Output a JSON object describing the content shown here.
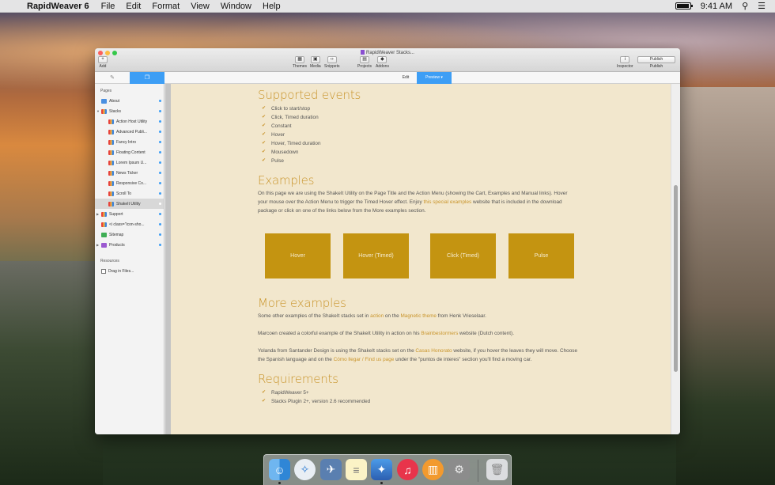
{
  "menubar": {
    "app_name": "RapidWeaver 6",
    "menus": [
      "File",
      "Edit",
      "Format",
      "View",
      "Window",
      "Help"
    ],
    "clock": "9:41 AM"
  },
  "window": {
    "title": "RapidWeaver Stacks...",
    "toolbar": {
      "add": "Add",
      "themes": "Themes",
      "media": "Media",
      "snippets": "Snippets",
      "projects": "Projects",
      "addons": "Addons",
      "inspector": "Inspector",
      "publish_button": "Publish",
      "publish": "Publish"
    },
    "modes": {
      "edit": "Edit",
      "preview": "Preview"
    }
  },
  "sidebar": {
    "pages_header": "Pages",
    "items": [
      {
        "label": "About",
        "icon": "page"
      },
      {
        "label": "Stacks",
        "icon": "stack"
      },
      {
        "label": "Action Host Utility",
        "icon": "stack"
      },
      {
        "label": "Advanced Publi...",
        "icon": "stack"
      },
      {
        "label": "Fancy Intro",
        "icon": "stack"
      },
      {
        "label": "Floating Content",
        "icon": "stack"
      },
      {
        "label": "Lorem Ipsum U...",
        "icon": "stack"
      },
      {
        "label": "News Ticker",
        "icon": "stack"
      },
      {
        "label": "Responsive Co...",
        "icon": "stack"
      },
      {
        "label": "Scroll To",
        "icon": "stack"
      },
      {
        "label": "ShakeIt Utility",
        "icon": "stack"
      },
      {
        "label": "Support",
        "icon": "stack"
      },
      {
        "label": "<i class=\"icon-sho...",
        "icon": "stack"
      },
      {
        "label": "Sitemap",
        "icon": "sitemap"
      },
      {
        "label": "Products",
        "icon": "products"
      }
    ],
    "resources_header": "Resources",
    "drag_files": "Drag in Files..."
  },
  "content": {
    "supported_title": "Supported events",
    "events": [
      "Click to start/stop",
      "Click, Timed duration",
      "Constant",
      "Hover",
      "Hover, Timed duration",
      "Mousedown",
      "Pulse"
    ],
    "examples_title": "Examples",
    "examples_para_1": "On this page we are using the ShakeIt Utility on the Page Title and the Action Menu (showing the Cart, Examples and Manual links). Hover your mouse over the Action Menu to trigger the Timed Hover effect. Enjoy ",
    "examples_link": "this special examples",
    "examples_para_2": " website that is included in the download package or click on one of the links below from the More examples section.",
    "example_buttons": [
      "Hover",
      "Hover (Timed)",
      "Click (Timed)",
      "Pulse"
    ],
    "more_title": "More examples",
    "more_p1_a": "Some other examples of the ShakeIt stacks set in ",
    "more_p1_link1": "action",
    "more_p1_b": " on the ",
    "more_p1_link2": "Magnetic theme",
    "more_p1_c": " from Henk Vrieselaar.",
    "more_p2_a": "Marcoen created a colorful example of the ShakeIt Utility in action on his ",
    "more_p2_link": "Brainbestormers",
    "more_p2_b": " website (Dutch content).",
    "more_p3_a": "Yolanda from Santander Design is using the ShakeIt stacks set on the ",
    "more_p3_link1": "Casas Honorato",
    "more_p3_b": " website, if you hover the leaves they will move. Choose the Spanish language and on the ",
    "more_p3_link2": "Cómo llegar / Find us page",
    "more_p3_c": " under the \"puntos de interes\" section you'll find a moving car.",
    "req_title": "Requirements",
    "requirements": [
      "RapidWeaver 5+",
      "Stacks Plugin 2+, version 2.6 recommended"
    ]
  },
  "dock": {
    "apps": [
      "finder",
      "safari",
      "xcode-preview",
      "notes",
      "rapidweaver",
      "itunes",
      "ibooks",
      "system-preferences",
      "trash"
    ]
  }
}
